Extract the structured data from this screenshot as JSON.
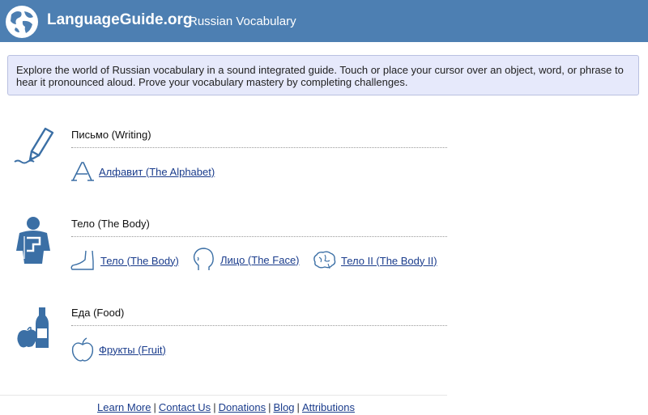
{
  "header": {
    "brand": "LanguageGuide.org",
    "separator": "·",
    "subtitle": "Russian Vocabulary"
  },
  "intro": {
    "text": "Explore the world of Russian vocabulary in a sound integrated guide. Touch or place your cursor over an object, word, or phrase to hear it pronounced aloud. Prove your vocabulary mastery by completing challenges."
  },
  "sections": [
    {
      "title": "Письмо (Writing)",
      "icon": "pencil-icon",
      "links": [
        {
          "label": "Алфавит (The Alphabet)",
          "icon": "letter-a-icon"
        }
      ]
    },
    {
      "title": "Тело (The Body)",
      "icon": "body-icon",
      "links": [
        {
          "label": "Тело (The Body)",
          "icon": "foot-icon"
        },
        {
          "label": "Лицо (The Face)",
          "icon": "face-icon"
        },
        {
          "label": "Тело II (The Body II)",
          "icon": "brain-icon"
        }
      ]
    },
    {
      "title": "Еда (Food)",
      "icon": "food-icon",
      "links": [
        {
          "label": "Фрукты (Fruit)",
          "icon": "apple-icon"
        }
      ]
    }
  ],
  "footer": {
    "links": [
      "Learn More",
      "Contact Us",
      "Donations",
      "Blog",
      "Attributions"
    ],
    "separator": "|"
  },
  "colors": {
    "header_bg": "#4d7fb2",
    "icon_blue": "#3b6fa5",
    "link": "#1a3c8c",
    "intro_bg": "#e6e9fb"
  }
}
